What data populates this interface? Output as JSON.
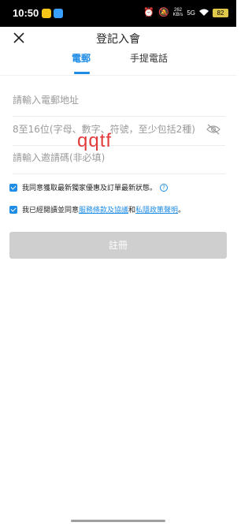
{
  "status_bar": {
    "time": "10:50",
    "net_speed_top": "262",
    "net_speed_bottom": "KB/s",
    "network": "5G",
    "battery": "82",
    "icons": [
      "alarm-icon",
      "mute-icon",
      "wifi-icon",
      "signal-icon"
    ]
  },
  "header": {
    "title": "登記入會"
  },
  "tabs": [
    {
      "label": "電郵",
      "active": true
    },
    {
      "label": "手提電話",
      "active": false
    }
  ],
  "form": {
    "email_placeholder": "請輸入電郵地址",
    "password_placeholder": "8至16位(字母、數字、符號，至少包括2種)",
    "invite_placeholder": "請輸入邀請碼(非必填)"
  },
  "watermark": "qqtf",
  "consents": {
    "marketing_text": "我同意獲取最新獨家優惠及訂單最新狀態。",
    "terms_prefix": "我已經閱讀並同意",
    "terms_link": "服務條款及協議",
    "terms_and": "和",
    "privacy_link": "私隱政策聲明",
    "terms_suffix": "。"
  },
  "submit_label": "註冊",
  "colors": {
    "accent": "#1f8ce6",
    "button_disabled": "#cfcfcf",
    "watermark": "#e23b3b"
  }
}
